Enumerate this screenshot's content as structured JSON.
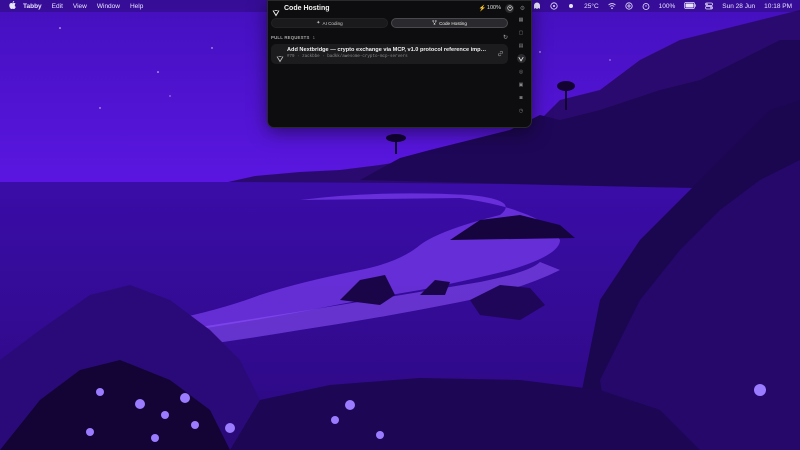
{
  "menubar": {
    "apple_icon": "apple-icon",
    "items": [
      "Tabby",
      "Edit",
      "View",
      "Window",
      "Help"
    ],
    "status": {
      "temperature": "25°C",
      "battery": "100%",
      "date": "Sun 28 Jun",
      "time": "10:18 PM"
    }
  },
  "popover": {
    "title": "Code Hosting",
    "battery": "100%",
    "tabs": [
      {
        "label": "AI Coding",
        "icon": "sparkle-icon",
        "active": false
      },
      {
        "label": "Code Hosting",
        "icon": "git-branch-icon",
        "active": true
      }
    ],
    "section": {
      "label": "PULL REQUESTS",
      "count": "1"
    },
    "pull_request": {
      "title": "Add Nextbridge — crypto exchange via MCP, v1.0 protocol reference implemen...",
      "meta": "#79 · zackbbe · badkk/awesome-crypto-mcp-servers"
    }
  },
  "colors": {
    "wallpaper_sky": "#5a16e0",
    "wallpaper_dark": "#2a0870",
    "panel_bg": "#0d0d0f",
    "accent_green": "#3ddc6a"
  }
}
